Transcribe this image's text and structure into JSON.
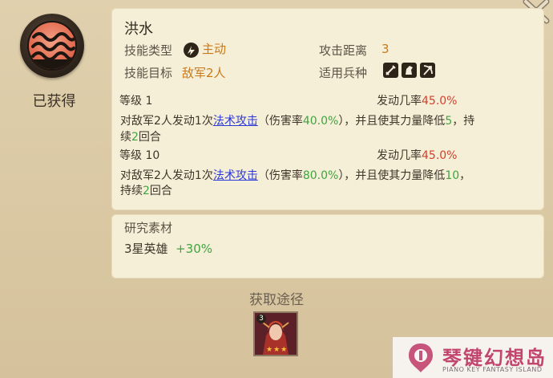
{
  "skill": {
    "status": "已获得",
    "name": "洪水",
    "type_label": "技能类型",
    "type_value": "主动",
    "range_label": "攻击距离",
    "range_value": "3",
    "target_label": "技能目标",
    "target_value": "敌军2人",
    "troops_label": "适用兵种",
    "troop_icons": [
      "sword-troop-icon",
      "cavalry-troop-icon",
      "bow-troop-icon"
    ]
  },
  "levels": [
    {
      "level_label": "等级 1",
      "rate_label": "发动几率",
      "rate_value": "45.0%",
      "desc_a": "对敌军2人发动1次",
      "desc_link": "法术攻击",
      "desc_b": "（伤害率",
      "damage": "40.0%",
      "desc_c": "），并且使其力量降低",
      "reduce": "5",
      "desc_d": "，持",
      "desc_e": "续",
      "turns": "2",
      "desc_f": "回合"
    },
    {
      "level_label": "等级 10",
      "rate_label": "发动几率",
      "rate_value": "45.0%",
      "desc_a": "对敌军2人发动1次",
      "desc_link": "法术攻击",
      "desc_b": "（伤害率",
      "damage": "80.0%",
      "desc_c": "），并且使其力量降低",
      "reduce": "10",
      "desc_d": "，",
      "desc_e": "持续",
      "turns": "2",
      "desc_f": "回合"
    }
  ],
  "research": {
    "title": "研究素材",
    "item": "3星英雄",
    "bonus": "+30%"
  },
  "obtain": {
    "title": "获取途径",
    "hero_stars": "3",
    "hero_star_count": 3
  },
  "watermark": {
    "name": "琴键幻想岛",
    "sub": "PIANO KEY FANTASY ISLAND"
  },
  "colors": {
    "orange": "#c97a17",
    "red": "#d2402c",
    "green": "#3fa53f",
    "link": "#2b38d6"
  }
}
